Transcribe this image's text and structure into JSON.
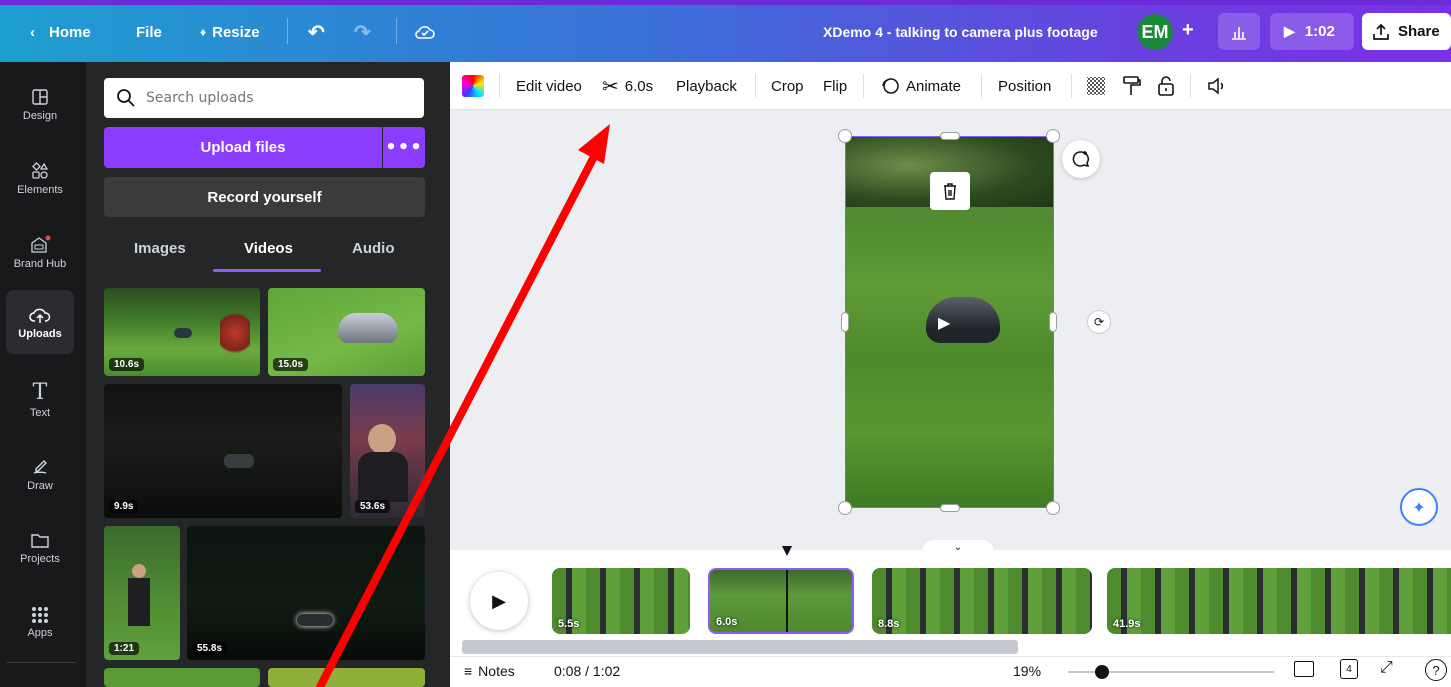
{
  "topbar": {
    "home": "Home",
    "file": "File",
    "resize": "Resize",
    "doc_title": "XDemo 4 - talking to camera plus footage",
    "avatar": "EM",
    "add_symbol": "+",
    "play_time": "1:02",
    "share": "Share"
  },
  "rail": [
    {
      "label": "Design",
      "icon": "layout-icon"
    },
    {
      "label": "Elements",
      "icon": "shapes-icon"
    },
    {
      "label": "Brand Hub",
      "icon": "brand-icon"
    },
    {
      "label": "Uploads",
      "icon": "cloud-upload-icon"
    },
    {
      "label": "Text",
      "icon": "text-icon"
    },
    {
      "label": "Draw",
      "icon": "draw-icon"
    },
    {
      "label": "Projects",
      "icon": "folder-icon"
    },
    {
      "label": "Apps",
      "icon": "apps-grid-icon"
    }
  ],
  "panel": {
    "search_placeholder": "Search uploads",
    "upload_label": "Upload files",
    "more_label": "•••",
    "record_label": "Record yourself",
    "tabs": [
      "Images",
      "Videos",
      "Audio"
    ],
    "active_tab": "Videos",
    "thumbs": [
      "10.6s",
      "15.0s",
      "9.9s",
      "53.6s",
      "1:21",
      "55.8s"
    ]
  },
  "toolbar": {
    "edit_video": "Edit video",
    "trim": "6.0s",
    "playback": "Playback",
    "crop": "Crop",
    "flip": "Flip",
    "animate": "Animate",
    "position": "Position"
  },
  "timeline": {
    "clips": [
      "5.5s",
      "6.0s",
      "8.8s",
      "41.9s"
    ]
  },
  "bottombar": {
    "notes": "Notes",
    "time": "0:08 / 1:02",
    "zoom": "19%",
    "pages": "4"
  },
  "colors": {
    "accent": "#8b3dff",
    "selection": "#8b5cf6",
    "annotation": "#ff0000"
  }
}
